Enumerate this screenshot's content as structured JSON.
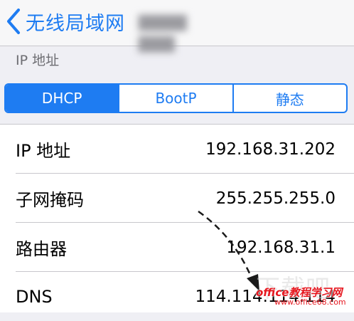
{
  "nav": {
    "back_label": "无线局域网",
    "network_name": "▇▇▇▇ ▇▇▇"
  },
  "section": {
    "header": "IP 地址"
  },
  "segments": [
    {
      "label": "DHCP",
      "selected": true
    },
    {
      "label": "BootP",
      "selected": false
    },
    {
      "label": "静态",
      "selected": false
    }
  ],
  "rows": [
    {
      "label": "IP 地址",
      "value": "192.168.31.202"
    },
    {
      "label": "子网掩码",
      "value": "255.255.255.0"
    },
    {
      "label": "路由器",
      "value": "192.168.31.1"
    },
    {
      "label": "DNS",
      "value": "114.114.114.114"
    }
  ],
  "watermark": {
    "big": "下载吧",
    "brand": "office教程学习网",
    "url": "www.office68.com"
  },
  "colors": {
    "accent": "#1e7cf2",
    "watermark_red": "#e6171f"
  },
  "icons": {
    "back": "chevron-left-icon",
    "annotation": "dashed-arrow-icon"
  }
}
